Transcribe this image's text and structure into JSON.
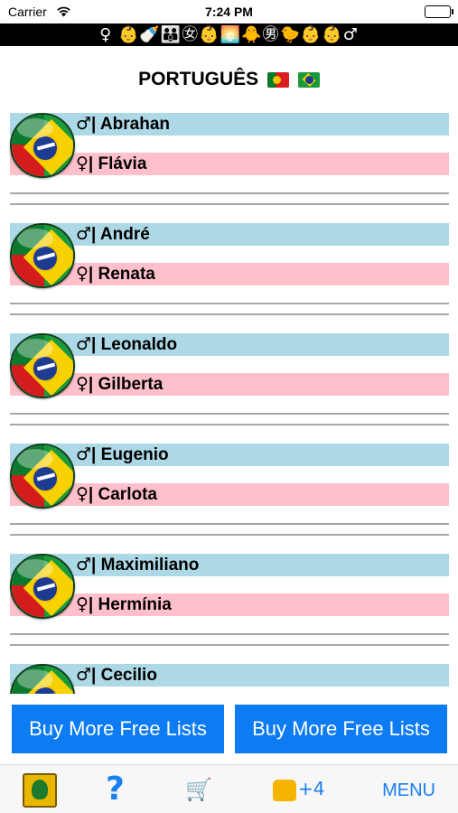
{
  "status_bar": {
    "carrier": "Carrier",
    "time": "7:24 PM"
  },
  "banner": {
    "emoji": "♀ 👶🍼👪㊛👶🌅🐥㊚🐤👶👶♂"
  },
  "title": {
    "text": "PORTUGUÊS"
  },
  "names": [
    {
      "male_symbol": "♂",
      "male": "| Abrahan",
      "female_symbol": "♀",
      "female": "| Flávia"
    },
    {
      "male_symbol": "♂",
      "male": "| André",
      "female_symbol": "♀",
      "female": "| Renata"
    },
    {
      "male_symbol": "♂",
      "male": "| Leonaldo",
      "female_symbol": "♀",
      "female": "| Gilberta"
    },
    {
      "male_symbol": "♂",
      "male": "| Eugenio",
      "female_symbol": "♀",
      "female": "| Carlota"
    },
    {
      "male_symbol": "♂",
      "male": "| Maximiliano",
      "female_symbol": "♀",
      "female": "| Hermínia"
    },
    {
      "male_symbol": "♂",
      "male": "| Cecilio",
      "female_symbol": "♀",
      "female": ""
    }
  ],
  "buttons": {
    "buy_left": "Buy More Free Lists",
    "buy_right": "Buy More Free Lists"
  },
  "tabbar": {
    "help": "?",
    "cart": "🛒",
    "like_count": "+4",
    "menu": "MENU"
  },
  "colors": {
    "male_bar": "#add8e6",
    "female_bar": "#ffc0cb",
    "button": "#0d7bf2",
    "tab_accent": "#1a7ff0"
  }
}
